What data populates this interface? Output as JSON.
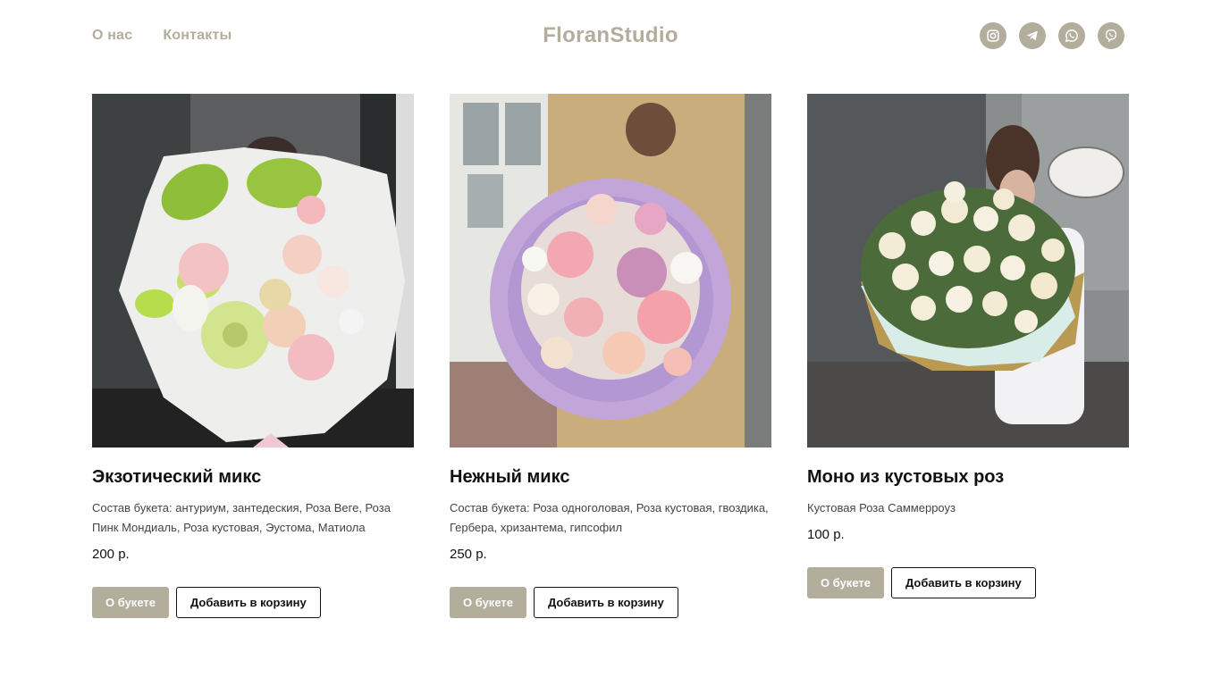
{
  "header": {
    "nav": [
      {
        "label": "О нас"
      },
      {
        "label": "Контакты"
      }
    ],
    "logo": "FloranStudio",
    "socials": [
      {
        "icon": "instagram-icon"
      },
      {
        "icon": "telegram-icon"
      },
      {
        "icon": "whatsapp-icon"
      },
      {
        "icon": "viber-icon"
      }
    ]
  },
  "colors": {
    "accent": "#b3ad9c",
    "text": "#111111"
  },
  "products": [
    {
      "title": "Экзотический микс",
      "composition": "Состав букета: антуриум, зантедеския, Роза Веге, Роза Пинк Мондиаль, Роза кустовая, Эустома, Матиола",
      "price": "200 р.",
      "about_label": "О букете",
      "cart_label": "Добавить в корзину"
    },
    {
      "title": "Нежный микс",
      "composition": "Состав букета: Роза одноголовая, Роза кустовая, гвоздика, Гербера, хризантема, гипсофил",
      "price": "250 р.",
      "about_label": "О букете",
      "cart_label": "Добавить в корзину"
    },
    {
      "title": "Моно из кустовых роз",
      "composition": "Кустовая Роза Саммерроуз",
      "price": "100 р.",
      "about_label": "О букете",
      "cart_label": "Добавить в корзину"
    }
  ]
}
